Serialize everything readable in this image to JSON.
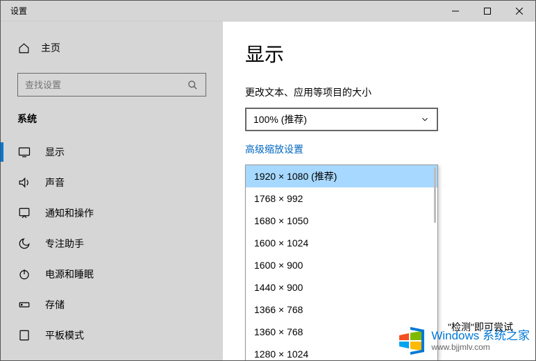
{
  "titlebar": {
    "title": "设置"
  },
  "sidebar": {
    "home": "主页",
    "search_placeholder": "查找设置",
    "section": "系统",
    "items": [
      {
        "label": "显示"
      },
      {
        "label": "声音"
      },
      {
        "label": "通知和操作"
      },
      {
        "label": "专注助手"
      },
      {
        "label": "电源和睡眠"
      },
      {
        "label": "存储"
      },
      {
        "label": "平板模式"
      }
    ]
  },
  "main": {
    "title": "显示",
    "scale_label": "更改文本、应用等项目的大小",
    "scale_value": "100% (推荐)",
    "advanced_link": "高级缩放设置",
    "resolutions": [
      "1920 × 1080 (推荐)",
      "1768 × 992",
      "1680 × 1050",
      "1600 × 1024",
      "1600 × 900",
      "1440 × 900",
      "1366 × 768",
      "1360 × 768",
      "1280 × 1024"
    ],
    "hint_fragment": "\"检测\"即可尝试"
  },
  "watermark": {
    "brand": "Windows 系统之家",
    "url": "www.bjjmlv.com"
  }
}
